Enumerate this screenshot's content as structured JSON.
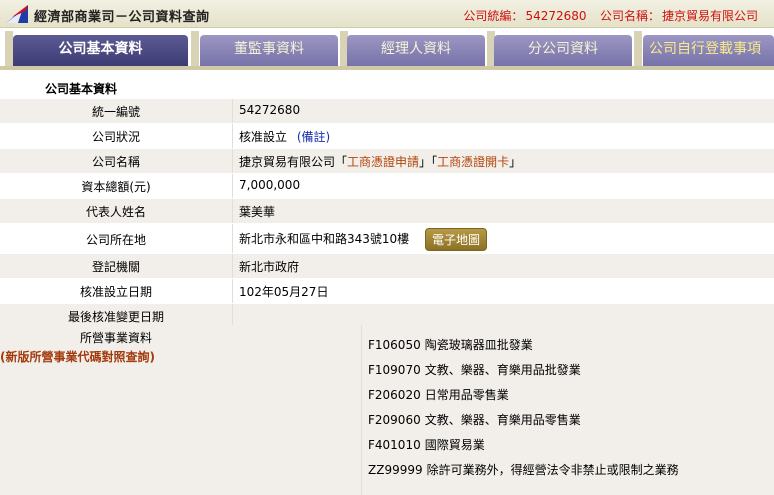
{
  "header": {
    "title": "經濟部商業司－公司資料查詢",
    "ban_label": "公司統編：",
    "ban_value": "54272680",
    "name_label": "公司名稱：",
    "name_value": "捷京貿易有限公司"
  },
  "tabs": [
    {
      "label": "公司基本資料",
      "active": true
    },
    {
      "label": "董監事資料",
      "active": false
    },
    {
      "label": "經理人資料",
      "active": false
    },
    {
      "label": "分公司資料",
      "active": false
    },
    {
      "label": "公司自行登載事項",
      "active": false
    }
  ],
  "section_title": "公司基本資料",
  "fields": {
    "ban": {
      "label": "統一編號",
      "value": "54272680"
    },
    "status": {
      "label": "公司狀況",
      "value": "核准設立",
      "note_link": "(備註)"
    },
    "name": {
      "label": "公司名稱",
      "value": "捷京貿易有限公司",
      "link1": "工商憑證申請",
      "link2": "工商憑證開卡",
      "q_open": "「",
      "q_close": "」"
    },
    "capital": {
      "label": "資本總額(元)",
      "value": "7,000,000"
    },
    "rep": {
      "label": "代表人姓名",
      "value": "葉美華"
    },
    "address": {
      "label": "公司所在地",
      "value": "新北市永和區中和路343號10樓",
      "map_button": "電子地圖"
    },
    "authority": {
      "label": "登記機關",
      "value": "新北市政府"
    },
    "approval_date": {
      "label": "核准設立日期",
      "value": "102年05月27日"
    },
    "last_change": {
      "label": "最後核准變更日期",
      "value": ""
    }
  },
  "business": {
    "label": "所營事業資料",
    "lookup_link": "(新版所營事業代碼對照查詢)",
    "items": [
      {
        "code": "F106050",
        "desc": "陶瓷玻璃器皿批發業"
      },
      {
        "code": "F109070",
        "desc": "文教、樂器、育樂用品批發業"
      },
      {
        "code": "F206020",
        "desc": "日常用品零售業"
      },
      {
        "code": "F209060",
        "desc": "文教、樂器、育樂用品零售業"
      },
      {
        "code": "F401010",
        "desc": "國際貿易業"
      },
      {
        "code": "ZZ99999",
        "desc": "除許可業務外，得經營法令非禁止或限制之業務"
      }
    ]
  },
  "colors": {
    "accent_red": "#d01010",
    "tab_active": "#3d3c73",
    "tab_inactive": "#7772a8",
    "link_blue": "#1a2fa8",
    "link_brown": "#b2440a"
  }
}
